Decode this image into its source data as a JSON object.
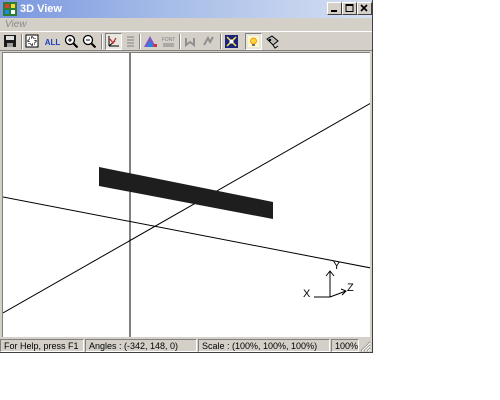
{
  "window": {
    "title": "3D View"
  },
  "menu": {
    "items": [
      {
        "label": "View"
      }
    ]
  },
  "toolbar": {
    "buttons": [
      {
        "name": "save",
        "icon": "save-icon"
      },
      {
        "name": "zoom-region",
        "icon": "zoom-region-icon"
      },
      {
        "name": "zoom-all",
        "icon": "zoom-all-icon",
        "label": "ALL"
      },
      {
        "name": "zoom-in",
        "icon": "zoom-in-icon"
      },
      {
        "name": "zoom-out",
        "icon": "zoom-out-icon"
      },
      {
        "name": "axes",
        "icon": "axes-icon",
        "pressed": true
      },
      {
        "name": "list",
        "icon": "list-icon"
      },
      {
        "name": "color-scale",
        "icon": "color-scale-icon"
      },
      {
        "name": "font",
        "icon": "font-icon",
        "label": "FONT"
      },
      {
        "name": "undo",
        "icon": "undo-icon"
      },
      {
        "name": "redo",
        "icon": "redo-icon"
      },
      {
        "name": "fit-view",
        "icon": "fit-view-icon"
      },
      {
        "name": "light",
        "icon": "light-icon",
        "pressed": true
      },
      {
        "name": "render",
        "icon": "render-icon"
      }
    ]
  },
  "axis_indicator": {
    "x_label": "X",
    "y_label": "Y",
    "z_label": "Z"
  },
  "status_bar": {
    "help": "For Help, press F1",
    "angles": "Angles : (-342, 148, 0)",
    "scale": "Scale : (100%, 100%, 100%)",
    "zoom": "100%"
  },
  "colors": {
    "title_gradient_start": "#7a96df",
    "title_gradient_end": "#d6dff2",
    "chrome": "#d4d0c8",
    "object": "#1e1e1e"
  }
}
